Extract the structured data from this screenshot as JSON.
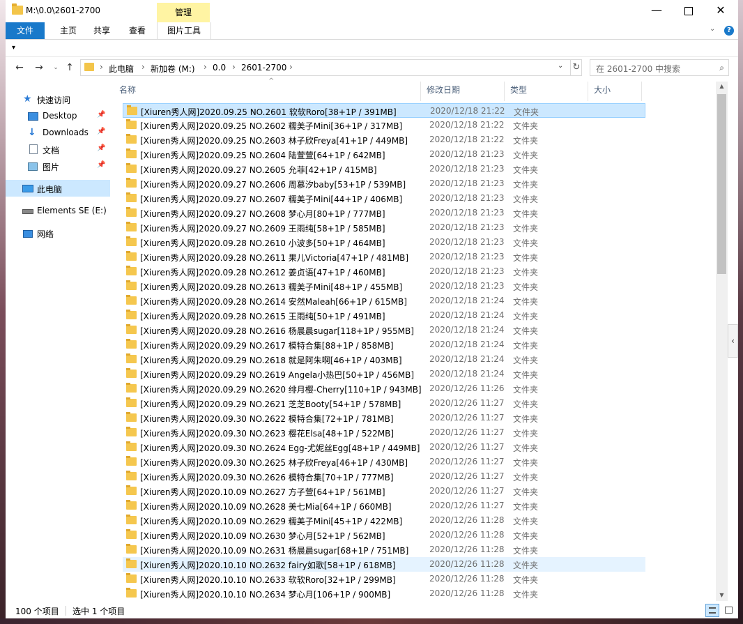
{
  "window": {
    "title": "M:\\0.0\\2601-2700",
    "controls": {
      "minimize": "—",
      "maximize": "",
      "close": "✕"
    }
  },
  "ribbon": {
    "context_tab": "管理",
    "tabs": {
      "file": "文件",
      "home": "主页",
      "share": "共享",
      "view": "查看",
      "picture_tools": "图片工具"
    },
    "help": "?"
  },
  "address": {
    "crumbs": [
      "此电脑",
      "新加卷 (M:)",
      "0.0",
      "2601-2700"
    ],
    "separator": "›",
    "search_placeholder": "在 2601-2700 中搜索"
  },
  "nav_pane": {
    "quick_access": "快速访问",
    "items": [
      {
        "label": "Desktop",
        "icon": "desktop-icon"
      },
      {
        "label": "Downloads",
        "icon": "download-icon"
      },
      {
        "label": "文档",
        "icon": "document-icon"
      },
      {
        "label": "图片",
        "icon": "picture-icon"
      }
    ],
    "this_pc": "此电脑",
    "drive": "Elements SE (E:)",
    "network": "网络"
  },
  "columns": {
    "name": "名称",
    "date": "修改日期",
    "type": "类型",
    "size": "大小"
  },
  "files": [
    {
      "name": "[Xiuren秀人网]2020.09.25 NO.2601 软软Roro[38+1P / 391MB]",
      "date": "2020/12/18 21:22",
      "type": "文件夹"
    },
    {
      "name": "[Xiuren秀人网]2020.09.25 NO.2602 糯美子Mini[36+1P / 317MB]",
      "date": "2020/12/18 21:22",
      "type": "文件夹"
    },
    {
      "name": "[Xiuren秀人网]2020.09.25 NO.2603 林子欣Freya[41+1P / 449MB]",
      "date": "2020/12/18 21:22",
      "type": "文件夹"
    },
    {
      "name": "[Xiuren秀人网]2020.09.25 NO.2604 陆萱萱[64+1P / 642MB]",
      "date": "2020/12/18 21:23",
      "type": "文件夹"
    },
    {
      "name": "[Xiuren秀人网]2020.09.27 NO.2605 允菲[42+1P / 415MB]",
      "date": "2020/12/18 21:23",
      "type": "文件夹"
    },
    {
      "name": "[Xiuren秀人网]2020.09.27 NO.2606 周慕汐baby[53+1P / 539MB]",
      "date": "2020/12/18 21:23",
      "type": "文件夹"
    },
    {
      "name": "[Xiuren秀人网]2020.09.27 NO.2607 糯美子Mini[44+1P / 406MB]",
      "date": "2020/12/18 21:23",
      "type": "文件夹"
    },
    {
      "name": "[Xiuren秀人网]2020.09.27 NO.2608 梦心月[80+1P / 777MB]",
      "date": "2020/12/18 21:23",
      "type": "文件夹"
    },
    {
      "name": "[Xiuren秀人网]2020.09.27 NO.2609 王雨纯[58+1P / 585MB]",
      "date": "2020/12/18 21:23",
      "type": "文件夹"
    },
    {
      "name": "[Xiuren秀人网]2020.09.28 NO.2610 小波多[50+1P / 464MB]",
      "date": "2020/12/18 21:23",
      "type": "文件夹"
    },
    {
      "name": "[Xiuren秀人网]2020.09.28 NO.2611 果儿Victoria[47+1P / 481MB]",
      "date": "2020/12/18 21:23",
      "type": "文件夹"
    },
    {
      "name": "[Xiuren秀人网]2020.09.28 NO.2612 姜贞语[47+1P / 460MB]",
      "date": "2020/12/18 21:23",
      "type": "文件夹"
    },
    {
      "name": "[Xiuren秀人网]2020.09.28 NO.2613 糯美子Mini[48+1P / 455MB]",
      "date": "2020/12/18 21:23",
      "type": "文件夹"
    },
    {
      "name": "[Xiuren秀人网]2020.09.28 NO.2614 安然Maleah[66+1P / 615MB]",
      "date": "2020/12/18 21:24",
      "type": "文件夹"
    },
    {
      "name": "[Xiuren秀人网]2020.09.28 NO.2615 王雨纯[50+1P / 491MB]",
      "date": "2020/12/18 21:24",
      "type": "文件夹"
    },
    {
      "name": "[Xiuren秀人网]2020.09.28 NO.2616 杨晨晨sugar[118+1P / 955MB]",
      "date": "2020/12/18 21:24",
      "type": "文件夹"
    },
    {
      "name": "[Xiuren秀人网]2020.09.29 NO.2617 模特合集[88+1P / 858MB]",
      "date": "2020/12/18 21:24",
      "type": "文件夹"
    },
    {
      "name": "[Xiuren秀人网]2020.09.29 NO.2618 就是阿朱啊[46+1P / 403MB]",
      "date": "2020/12/18 21:24",
      "type": "文件夹"
    },
    {
      "name": "[Xiuren秀人网]2020.09.29 NO.2619 Angela小热巴[50+1P / 456MB]",
      "date": "2020/12/18 21:24",
      "type": "文件夹"
    },
    {
      "name": "[Xiuren秀人网]2020.09.29 NO.2620 绯月樱-Cherry[110+1P / 943MB]",
      "date": "2020/12/26 11:26",
      "type": "文件夹"
    },
    {
      "name": "[Xiuren秀人网]2020.09.29 NO.2621 芝芝Booty[54+1P / 578MB]",
      "date": "2020/12/26 11:27",
      "type": "文件夹"
    },
    {
      "name": "[Xiuren秀人网]2020.09.30 NO.2622 模特合集[72+1P / 781MB]",
      "date": "2020/12/26 11:27",
      "type": "文件夹"
    },
    {
      "name": "[Xiuren秀人网]2020.09.30 NO.2623 樱花Elsa[48+1P / 522MB]",
      "date": "2020/12/26 11:27",
      "type": "文件夹"
    },
    {
      "name": "[Xiuren秀人网]2020.09.30 NO.2624 Egg-尤妮丝Egg[48+1P / 449MB]",
      "date": "2020/12/26 11:27",
      "type": "文件夹"
    },
    {
      "name": "[Xiuren秀人网]2020.09.30 NO.2625 林子欣Freya[46+1P / 430MB]",
      "date": "2020/12/26 11:27",
      "type": "文件夹"
    },
    {
      "name": "[Xiuren秀人网]2020.09.30 NO.2626 模特合集[70+1P / 777MB]",
      "date": "2020/12/26 11:27",
      "type": "文件夹"
    },
    {
      "name": "[Xiuren秀人网]2020.10.09 NO.2627 方子萱[64+1P / 561MB]",
      "date": "2020/12/26 11:27",
      "type": "文件夹"
    },
    {
      "name": "[Xiuren秀人网]2020.10.09 NO.2628 美七Mia[64+1P / 660MB]",
      "date": "2020/12/26 11:27",
      "type": "文件夹"
    },
    {
      "name": "[Xiuren秀人网]2020.10.09 NO.2629 糯美子Mini[45+1P / 422MB]",
      "date": "2020/12/26 11:28",
      "type": "文件夹"
    },
    {
      "name": "[Xiuren秀人网]2020.10.09 NO.2630 梦心月[52+1P / 562MB]",
      "date": "2020/12/26 11:28",
      "type": "文件夹"
    },
    {
      "name": "[Xiuren秀人网]2020.10.09 NO.2631 杨晨晨sugar[68+1P / 751MB]",
      "date": "2020/12/26 11:28",
      "type": "文件夹"
    },
    {
      "name": "[Xiuren秀人网]2020.10.10 NO.2632 fairy如歌[58+1P / 618MB]",
      "date": "2020/12/26 11:28",
      "type": "文件夹"
    },
    {
      "name": "[Xiuren秀人网]2020.10.10 NO.2633 软软Roro[32+1P / 299MB]",
      "date": "2020/12/26 11:28",
      "type": "文件夹"
    },
    {
      "name": "[Xiuren秀人网]2020.10.10 NO.2634 梦心月[106+1P / 900MB]",
      "date": "2020/12/26 11:28",
      "type": "文件夹"
    }
  ],
  "status": {
    "count": "100 个项目",
    "selected": "选中 1 个项目"
  }
}
